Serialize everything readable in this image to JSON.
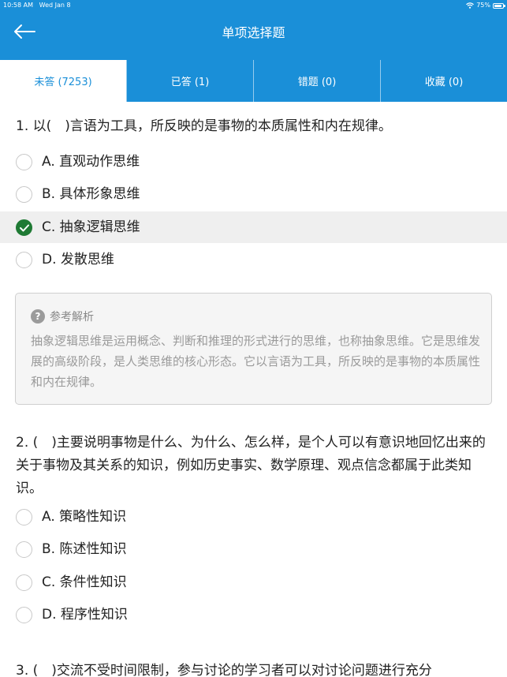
{
  "status_bar": {
    "time": "10:58 AM",
    "date": "Wed Jan 8",
    "battery": "75%"
  },
  "nav": {
    "title": "单项选择题",
    "back_icon": "arrow-left-icon"
  },
  "tabs": [
    {
      "label": "未答 (7253)"
    },
    {
      "label": "已答 (1)"
    },
    {
      "label": "错题 (0)"
    },
    {
      "label": "收藏 (0)"
    }
  ],
  "questions": [
    {
      "text": "1. 以(　)言语为工具，所反映的是事物的本质属性和内在规律。",
      "options": [
        "A. 直观动作思维",
        "B. 具体形象思维",
        "C. 抽象逻辑思维",
        "D. 发散思维"
      ],
      "selected_index": 2,
      "analysis": {
        "title": "参考解析",
        "text": "抽象逻辑思维是运用概念、判断和推理的形式进行的思维，也称抽象思维。它是思维发展的高级阶段，是人类思维的核心形态。它以言语为工具，所反映的是事物的本质属性和内在规律。"
      }
    },
    {
      "text": "2. (　)主要说明事物是什么、为什么、怎么样，是个人可以有意识地回忆出来的关于事物及其关系的知识，例如历史事实、数学原理、观点信念都属于此类知识。",
      "options": [
        "A. 策略性知识",
        "B. 陈述性知识",
        "C. 条件性知识",
        "D. 程序性知识"
      ]
    },
    {
      "text": "3. (　)交流不受时间限制，参与讨论的学习者可以对讨论问题进行充分"
    }
  ],
  "colors": {
    "primary": "#1a8fd8",
    "selected_check": "#1f7a34",
    "selected_row": "#efefef"
  }
}
